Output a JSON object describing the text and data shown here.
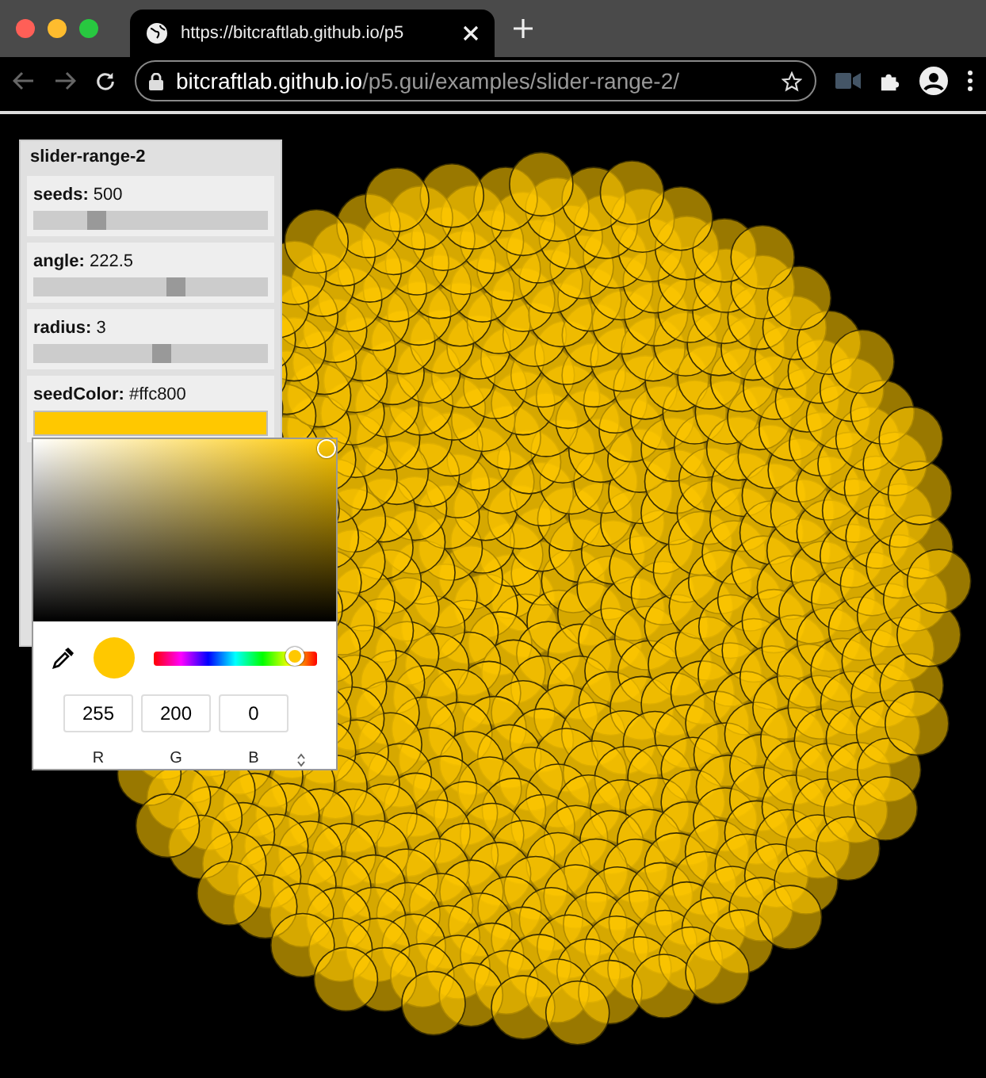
{
  "browser": {
    "tab_title": "https://bitcraftlab.github.io/p5",
    "url": "**bitcraftlab.github.io**/p5.gui/examples/slider-range-2/"
  },
  "panel": {
    "title": "slider-range-2",
    "controls": [
      {
        "kind": "slider",
        "label": "seeds:",
        "value": "500",
        "level": 0.27
      },
      {
        "kind": "slider",
        "label": "angle:",
        "value": "222.5",
        "level": 0.61
      },
      {
        "kind": "slider",
        "label": "radius:",
        "value": "3",
        "level": 0.55
      },
      {
        "kind": "color",
        "label": "seedColor:",
        "value": "#ffc800"
      }
    ]
  },
  "color_picker": {
    "hue_slider": {
      "level": 0.86
    },
    "channels": [
      {
        "value": "255",
        "label": "R"
      },
      {
        "value": "200",
        "label": "G"
      },
      {
        "value": "0",
        "label": "B"
      }
    ]
  }
}
